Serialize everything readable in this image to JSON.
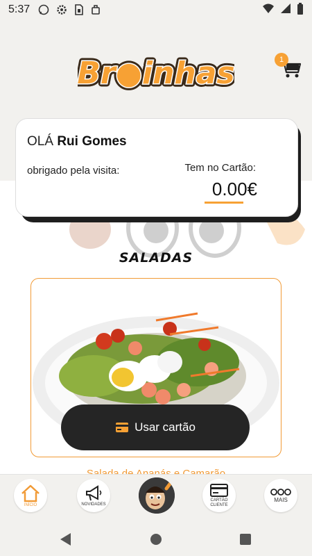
{
  "status_bar": {
    "time": "5:37",
    "icons": [
      "whatsapp-icon",
      "gear-icon",
      "sim-icon",
      "briefcase-icon",
      "wifi-icon",
      "signal-icon",
      "battery-icon"
    ]
  },
  "header": {
    "logo_text": "Br●inhas",
    "cart_count": "1"
  },
  "greeting": {
    "hello": "OLÁ",
    "user_name": "Rui Gomes",
    "thanks": "obrigado pela visita:",
    "card_label": "Tem no Cartão:",
    "balance": "0.00€"
  },
  "section": {
    "title": "SALADAS"
  },
  "product": {
    "button_label": "Usar cartão",
    "name": "Salada de Ananás e Camarão"
  },
  "bottom_nav": {
    "items": [
      {
        "label": "INÍCIO",
        "icon": "home-icon"
      },
      {
        "label": "NOVIDADES",
        "icon": "megaphone-icon"
      },
      {
        "label": "",
        "icon": "mascot-icon"
      },
      {
        "label": "CARTÃO CLIENTE",
        "icon": "card-icon"
      },
      {
        "label": "MAIS",
        "icon": "more-icon"
      }
    ]
  },
  "colors": {
    "accent": "#f19a35",
    "dark": "#252525",
    "background": "#f2f1ee"
  }
}
